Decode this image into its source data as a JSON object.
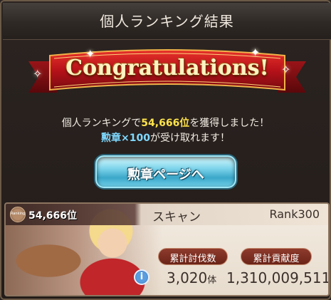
{
  "title": "個人ランキング結果",
  "banner": "Congratulations!",
  "message": {
    "line1_pre": "個人ランキングで",
    "line1_rank": "54,666位",
    "line1_post": "を獲得しました！",
    "line2_medal": "勲章×100",
    "line2_post": "が受け取れます！"
  },
  "medal_button_label": "勲章ページへ",
  "card": {
    "badge_text": "Ranking",
    "rank_position": "54,666位",
    "player_name": "スキャン",
    "player_rank": "Rank300",
    "stats": {
      "kills_label": "累計討伐数",
      "contrib_label": "累計貢献度",
      "kills_value": "3,020",
      "kills_unit": "体",
      "contrib_value": "1,310,009,511"
    },
    "info_icon_glyph": "i"
  },
  "colors": {
    "highlight_rank": "#ffe34a",
    "highlight_medal": "#7fd9ff",
    "ribbon_red": "#b8121a",
    "button_cyan": "#3ba7c9",
    "pill_brown": "#7b2c1e"
  },
  "icons": [
    "sparkle-icon",
    "ranking-badge-icon",
    "info-icon"
  ]
}
